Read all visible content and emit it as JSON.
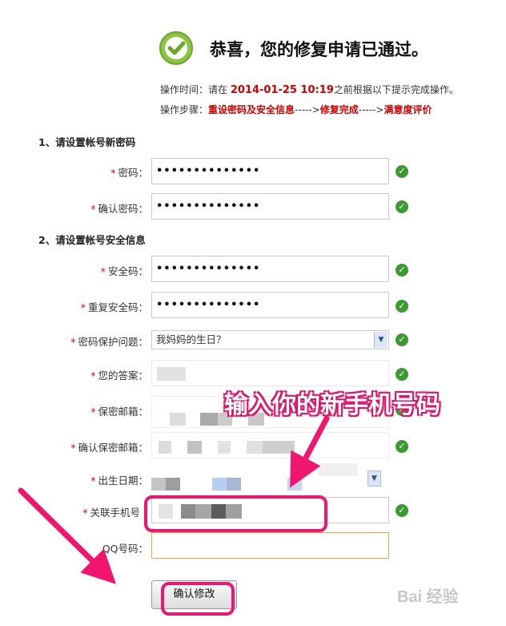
{
  "header": {
    "title": "恭喜，您的修复申请已通过。",
    "time_prefix": "操作时间：请在 ",
    "time_value": "2014-01-25 10:19",
    "time_suffix": "之前根据以下提示完成操作。",
    "steps_prefix": "操作步骤：",
    "step1": "重设密码及安全信息",
    "arrow1": "----->",
    "step2": "修复完成",
    "arrow2": "----->",
    "step3": "满意度评价"
  },
  "section1": {
    "title": "1、请设置帐号新密码",
    "password_label": "密码：",
    "password_value": "••••••••••••••",
    "confirm_label": "确认密码：",
    "confirm_value": "••••••••••••••"
  },
  "section2": {
    "title": "2、请设置帐号安全信息",
    "security_code_label": "安全码：",
    "security_code_value": "••••••••••••••",
    "repeat_code_label": "重复安全码：",
    "repeat_code_value": "••••••••••••••",
    "question_label": "密码保护问题：",
    "question_value": "我妈妈的生日？",
    "answer_label": "您的答案：",
    "email_label": "保密邮箱：",
    "confirm_email_label": "确认保密邮箱：",
    "birthday_label": "出生日期：",
    "phone_label": "关联手机号",
    "qq_label": "QQ号码："
  },
  "required_mark": "*",
  "annotation": "输入你的新手机号码",
  "submit_label": "确认修改",
  "watermark": "Bai 经验",
  "colors": {
    "accent_red": "#cc0000",
    "highlight_pink": "#f0156e",
    "check_green": "#3b9b2e"
  }
}
